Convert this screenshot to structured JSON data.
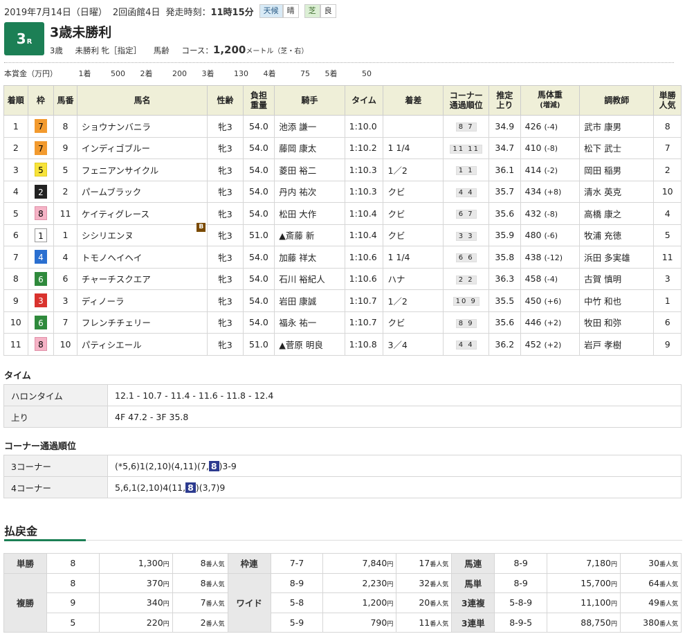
{
  "header": {
    "date": "2019年7月14日（日曜）",
    "meeting": "2回函館4日",
    "start_label": "発走時刻：",
    "start_time": "11時15分",
    "weather_key": "天候",
    "weather_val": "晴",
    "track_key": "芝",
    "track_val": "良",
    "race_no": "3",
    "race_no_suffix": "R",
    "title": "3歳未勝利",
    "cond1": "3歳",
    "cond2": "未勝利",
    "cond3": "牝［指定］",
    "cond4": "馬齢",
    "course_label": "コース：",
    "distance": "1,200",
    "distance_unit": "メートル（芝・右）"
  },
  "prize": {
    "label": "本賞金（万円）",
    "items": [
      {
        "pos": "1着",
        "val": "500"
      },
      {
        "pos": "2着",
        "val": "200"
      },
      {
        "pos": "3着",
        "val": "130"
      },
      {
        "pos": "4着",
        "val": "75"
      },
      {
        "pos": "5着",
        "val": "50"
      }
    ]
  },
  "results": {
    "headers": [
      "着順",
      "枠",
      "馬番",
      "馬名",
      "性齢",
      "負担",
      "重量",
      "騎手",
      "タイム",
      "着差",
      "コーナー",
      "通過順位",
      "推定",
      "上り",
      "馬体重",
      "(増減)",
      "調教師",
      "単勝",
      "人気"
    ],
    "rows": [
      {
        "rank": "1",
        "waku": "7",
        "uma": "8",
        "name": "ショウナンバニラ",
        "blinker": "",
        "sex": "牝3",
        "wt": "54.0",
        "jockey": "池添 謙一",
        "time": "1:10.0",
        "margin": "",
        "corner": "8 7",
        "last": "34.9",
        "bw": "426",
        "bwd": "(-4)",
        "trainer": "武市 康男",
        "pop": "8"
      },
      {
        "rank": "2",
        "waku": "7",
        "uma": "9",
        "name": "インディゴブルー",
        "blinker": "",
        "sex": "牝3",
        "wt": "54.0",
        "jockey": "藤岡 康太",
        "time": "1:10.2",
        "margin": "1 1/4",
        "corner": "11 11",
        "last": "34.7",
        "bw": "410",
        "bwd": "(-8)",
        "trainer": "松下 武士",
        "pop": "7"
      },
      {
        "rank": "3",
        "waku": "5",
        "uma": "5",
        "name": "フェニアンサイクル",
        "blinker": "",
        "sex": "牝3",
        "wt": "54.0",
        "jockey": "菱田 裕二",
        "time": "1:10.3",
        "margin": "1／2",
        "corner": "1 1",
        "last": "36.1",
        "bw": "414",
        "bwd": "(-2)",
        "trainer": "岡田 稲男",
        "pop": "2"
      },
      {
        "rank": "4",
        "waku": "2",
        "uma": "2",
        "name": "パームブラック",
        "blinker": "",
        "sex": "牝3",
        "wt": "54.0",
        "jockey": "丹内 祐次",
        "time": "1:10.3",
        "margin": "クビ",
        "corner": "4 4",
        "last": "35.7",
        "bw": "434",
        "bwd": "(+8)",
        "trainer": "清水 英克",
        "pop": "10"
      },
      {
        "rank": "5",
        "waku": "8",
        "uma": "11",
        "name": "ケイティグレース",
        "blinker": "",
        "sex": "牝3",
        "wt": "54.0",
        "jockey": "松田 大作",
        "time": "1:10.4",
        "margin": "クビ",
        "corner": "6 7",
        "last": "35.6",
        "bw": "432",
        "bwd": "(-8)",
        "trainer": "高橋 康之",
        "pop": "4"
      },
      {
        "rank": "6",
        "waku": "1",
        "uma": "1",
        "name": "シシリエンヌ",
        "blinker": "B",
        "sex": "牝3",
        "wt": "51.0",
        "jockey": "▲斎藤 新",
        "time": "1:10.4",
        "margin": "クビ",
        "corner": "3 3",
        "last": "35.9",
        "bw": "480",
        "bwd": "(-6)",
        "trainer": "牧浦 充徳",
        "pop": "5"
      },
      {
        "rank": "7",
        "waku": "4",
        "uma": "4",
        "name": "トモノヘイヘイ",
        "blinker": "",
        "sex": "牝3",
        "wt": "54.0",
        "jockey": "加藤 祥太",
        "time": "1:10.6",
        "margin": "1 1/4",
        "corner": "6 6",
        "last": "35.8",
        "bw": "438",
        "bwd": "(-12)",
        "trainer": "浜田 多実雄",
        "pop": "11"
      },
      {
        "rank": "8",
        "waku": "6",
        "uma": "6",
        "name": "チャーチスクエア",
        "blinker": "",
        "sex": "牝3",
        "wt": "54.0",
        "jockey": "石川 裕紀人",
        "time": "1:10.6",
        "margin": "ハナ",
        "corner": "2 2",
        "last": "36.3",
        "bw": "458",
        "bwd": "(-4)",
        "trainer": "古賀 慎明",
        "pop": "3"
      },
      {
        "rank": "9",
        "waku": "3",
        "uma": "3",
        "name": "ディノーラ",
        "blinker": "",
        "sex": "牝3",
        "wt": "54.0",
        "jockey": "岩田 康誠",
        "time": "1:10.7",
        "margin": "1／2",
        "corner": "10 9",
        "last": "35.5",
        "bw": "450",
        "bwd": "(+6)",
        "trainer": "中竹 和也",
        "pop": "1"
      },
      {
        "rank": "10",
        "waku": "6",
        "uma": "7",
        "name": "フレンチチェリー",
        "blinker": "",
        "sex": "牝3",
        "wt": "54.0",
        "jockey": "福永 祐一",
        "time": "1:10.7",
        "margin": "クビ",
        "corner": "8 9",
        "last": "35.6",
        "bw": "446",
        "bwd": "(+2)",
        "trainer": "牧田 和弥",
        "pop": "6"
      },
      {
        "rank": "11",
        "waku": "8",
        "uma": "10",
        "name": "パティシエール",
        "blinker": "",
        "sex": "牝3",
        "wt": "51.0",
        "jockey": "▲菅原 明良",
        "time": "1:10.8",
        "margin": "3／4",
        "corner": "4 4",
        "last": "36.2",
        "bw": "452",
        "bwd": "(+2)",
        "trainer": "岩戸 孝樹",
        "pop": "9"
      }
    ]
  },
  "waku_colors": {
    "1": {
      "bg": "#ffffff",
      "fg": "#000000",
      "border": "#999999"
    },
    "2": {
      "bg": "#222222",
      "fg": "#ffffff",
      "border": "#222222"
    },
    "3": {
      "bg": "#d9332e",
      "fg": "#ffffff",
      "border": "#d9332e"
    },
    "4": {
      "bg": "#2a6fd0",
      "fg": "#ffffff",
      "border": "#2a6fd0"
    },
    "5": {
      "bg": "#f7e33a",
      "fg": "#000000",
      "border": "#e0cc20"
    },
    "6": {
      "bg": "#2f8a3c",
      "fg": "#ffffff",
      "border": "#2f8a3c"
    },
    "7": {
      "bg": "#f29a2e",
      "fg": "#000000",
      "border": "#f29a2e"
    },
    "8": {
      "bg": "#f5b3c6",
      "fg": "#000000",
      "border": "#e090a8"
    }
  },
  "time_section": {
    "title": "タイム",
    "rows": [
      {
        "k": "ハロンタイム",
        "v": "12.1 - 10.7 - 11.4 - 11.6 - 11.8 - 12.4"
      },
      {
        "k": "上り",
        "v": "4F 47.2 - 3F 35.8"
      }
    ]
  },
  "corner_section": {
    "title": "コーナー通過順位",
    "rows": [
      {
        "k": "3コーナー",
        "pre": "(*5,6)1(2,10)(4,11)(7,",
        "hl": "8",
        "post": ")3-9"
      },
      {
        "k": "4コーナー",
        "pre": "5,6,1(2,10)4(11,",
        "hl": "8",
        "post": ")(3,7)9"
      }
    ]
  },
  "payout": {
    "title": "払戻金",
    "yen": "円",
    "pop_suffix": "番人気",
    "tansho": {
      "label": "単勝",
      "num": "8",
      "amt": "1,300",
      "pop": "8"
    },
    "fukusho": {
      "label": "複勝",
      "rows": [
        {
          "num": "8",
          "amt": "370",
          "pop": "8"
        },
        {
          "num": "9",
          "amt": "340",
          "pop": "7"
        },
        {
          "num": "5",
          "amt": "220",
          "pop": "2"
        }
      ]
    },
    "wakuren": {
      "label": "枠連",
      "num": "7-7",
      "amt": "7,840",
      "pop": "17"
    },
    "wide": {
      "label": "ワイド",
      "rows": [
        {
          "num": "8-9",
          "amt": "2,230",
          "pop": "32"
        },
        {
          "num": "5-8",
          "amt": "1,200",
          "pop": "20"
        },
        {
          "num": "5-9",
          "amt": "790",
          "pop": "11"
        }
      ]
    },
    "right": [
      {
        "label": "馬連",
        "num": "8-9",
        "amt": "7,180",
        "pop": "30"
      },
      {
        "label": "馬単",
        "num": "8-9",
        "amt": "15,700",
        "pop": "64"
      },
      {
        "label": "3連複",
        "num": "5-8-9",
        "amt": "11,100",
        "pop": "49"
      },
      {
        "label": "3連単",
        "num": "8-9-5",
        "amt": "88,750",
        "pop": "380"
      }
    ]
  }
}
